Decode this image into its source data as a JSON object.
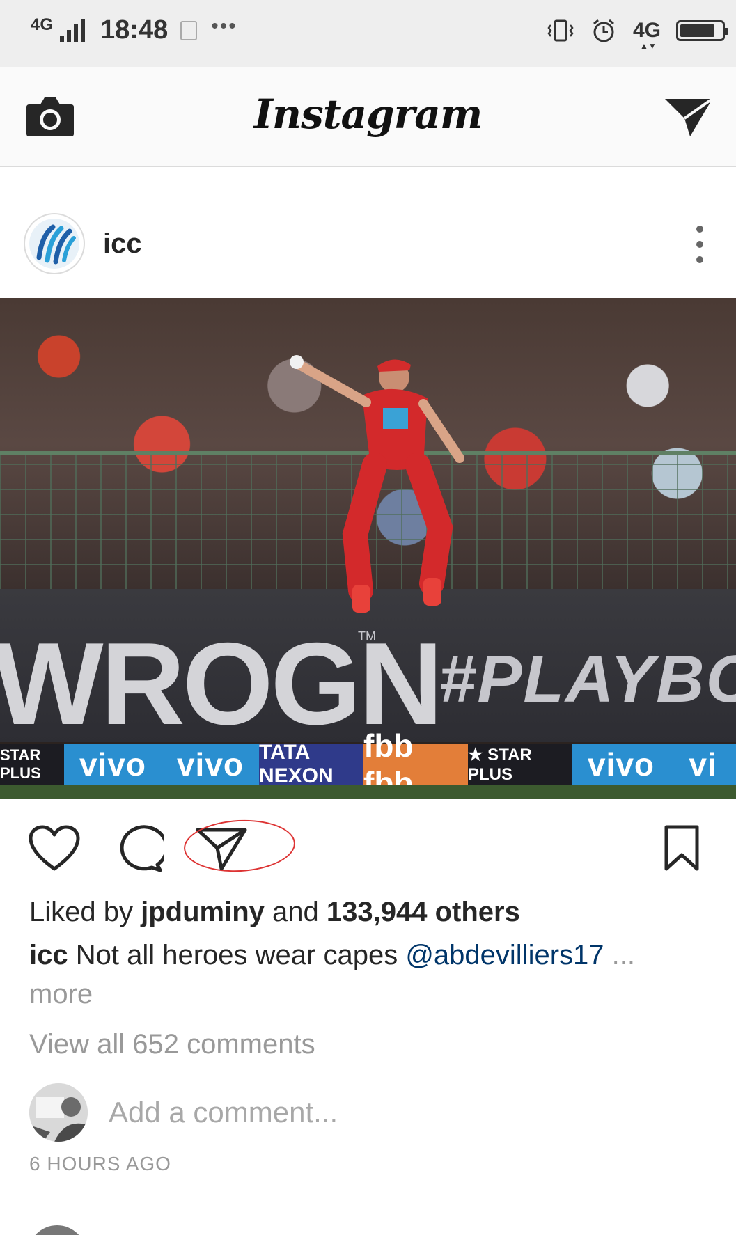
{
  "status_bar": {
    "network": "4G",
    "time": "18:48",
    "dots": "•••",
    "network_right": "4G",
    "battery_level": 0.85
  },
  "header": {
    "logo": "Instagram",
    "camera_icon": "camera-icon",
    "direct_icon": "direct-send-icon"
  },
  "post": {
    "username": "icc",
    "image": {
      "hoarding_text": "WROGN",
      "hoarding_tm": "TM",
      "hoarding_tag": "#PLAYBOLD",
      "ads": [
        "STAR PLUS",
        "vivo",
        "vivo",
        "TATA NEXON",
        "fbb fbb",
        "★ STAR PLUS",
        "vivo",
        "vi"
      ]
    },
    "actions": {
      "like_icon": "heart-icon",
      "comment_icon": "comment-icon",
      "share_icon": "share-icon",
      "save_icon": "bookmark-icon"
    },
    "likes": {
      "prefix": "Liked by",
      "user": "jpduminy",
      "conjunction": "and",
      "others": "133,944 others"
    },
    "caption": {
      "user": "icc",
      "text": "Not all heroes wear capes",
      "mention": "@abdevilliers17",
      "ellipsis": "...",
      "more": "more"
    },
    "view_comments": "View all 652 comments",
    "comment_placeholder": "Add a comment...",
    "timestamp": "6 HOURS AGO"
  },
  "colors": {
    "mention": "#003569",
    "secondary_text": "#999999",
    "annotation": "#dd3333"
  }
}
